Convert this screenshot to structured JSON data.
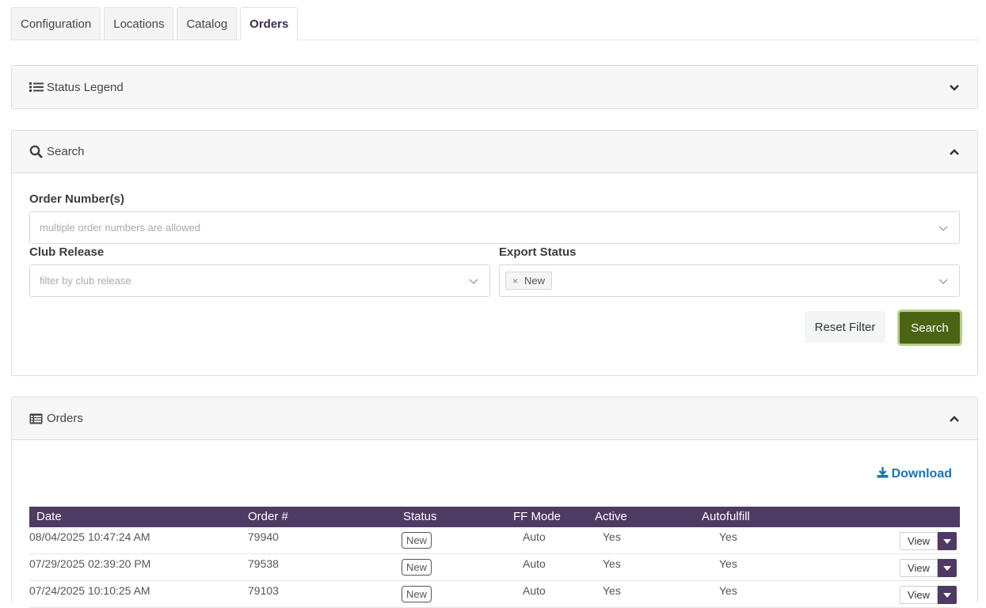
{
  "tabs": [
    {
      "label": "Configuration",
      "active": false
    },
    {
      "label": "Locations",
      "active": false
    },
    {
      "label": "Catalog",
      "active": false
    },
    {
      "label": "Orders",
      "active": true
    }
  ],
  "legend": {
    "title": "Status Legend"
  },
  "search": {
    "title": "Search",
    "order_numbers_label": "Order Number(s)",
    "order_numbers_placeholder": "multiple order numbers are allowed",
    "club_release_label": "Club Release",
    "club_release_placeholder": "filter by club release",
    "export_status_label": "Export Status",
    "export_status_tag": "New",
    "tag_remove": "×",
    "reset_label": "Reset Filter",
    "search_label": "Search"
  },
  "orders": {
    "title": "Orders",
    "download_label": "Download",
    "columns": [
      "Date",
      "Order #",
      "Status",
      "FF Mode",
      "Active",
      "Autofulfill"
    ],
    "rows": [
      {
        "date": "08/04/2025 10:47:24 AM",
        "order": "79940",
        "status": "New",
        "ff_mode": "Auto",
        "active": "Yes",
        "autofulfill": "Yes",
        "action": "View"
      },
      {
        "date": "07/29/2025 02:39:20 PM",
        "order": "79538",
        "status": "New",
        "ff_mode": "Auto",
        "active": "Yes",
        "autofulfill": "Yes",
        "action": "View"
      },
      {
        "date": "07/24/2025 10:10:25 AM",
        "order": "79103",
        "status": "New",
        "ff_mode": "Auto",
        "active": "Yes",
        "autofulfill": "Yes",
        "action": "View"
      }
    ]
  },
  "colors": {
    "header_purple": "#4e3a63",
    "search_green": "#4a6414",
    "link_blue": "#1a74b5"
  }
}
